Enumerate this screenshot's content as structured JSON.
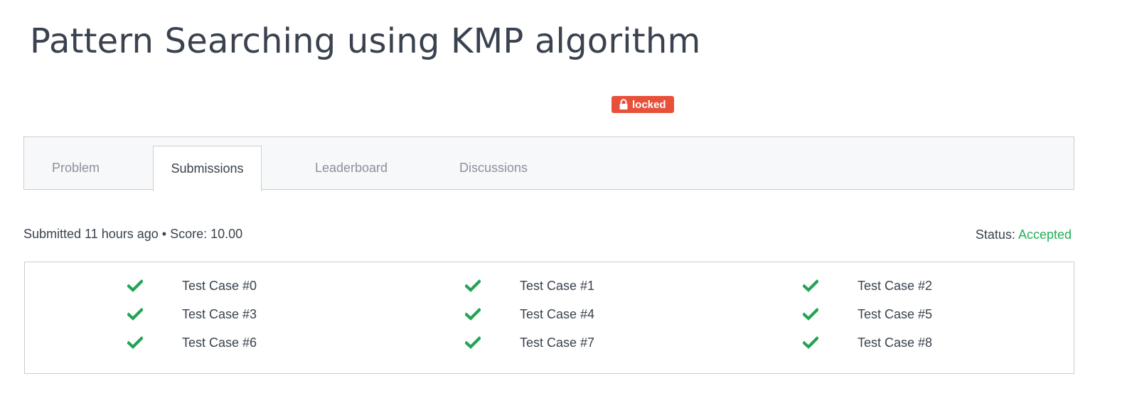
{
  "page": {
    "title": "Pattern Searching using KMP algorithm"
  },
  "badge": {
    "label": "locked",
    "icon": "lock-icon",
    "color": "#e8503a"
  },
  "tabs": [
    {
      "label": "Problem",
      "active": false
    },
    {
      "label": "Submissions",
      "active": true
    },
    {
      "label": "Leaderboard",
      "active": false
    },
    {
      "label": "Discussions",
      "active": false
    }
  ],
  "submission": {
    "summary": "Submitted 11 hours ago • Score: 10.00",
    "status_label": "Status:",
    "status_value": "Accepted",
    "status_color": "#23b054"
  },
  "test_cases": [
    {
      "label": "Test Case #0",
      "icon": "check-icon",
      "passed": true
    },
    {
      "label": "Test Case #1",
      "icon": "check-icon",
      "passed": true
    },
    {
      "label": "Test Case #2",
      "icon": "check-icon",
      "passed": true
    },
    {
      "label": "Test Case #3",
      "icon": "check-icon",
      "passed": true
    },
    {
      "label": "Test Case #4",
      "icon": "check-icon",
      "passed": true
    },
    {
      "label": "Test Case #5",
      "icon": "check-icon",
      "passed": true
    },
    {
      "label": "Test Case #6",
      "icon": "check-icon",
      "passed": true
    },
    {
      "label": "Test Case #7",
      "icon": "check-icon",
      "passed": true
    },
    {
      "label": "Test Case #8",
      "icon": "check-icon",
      "passed": true
    }
  ]
}
